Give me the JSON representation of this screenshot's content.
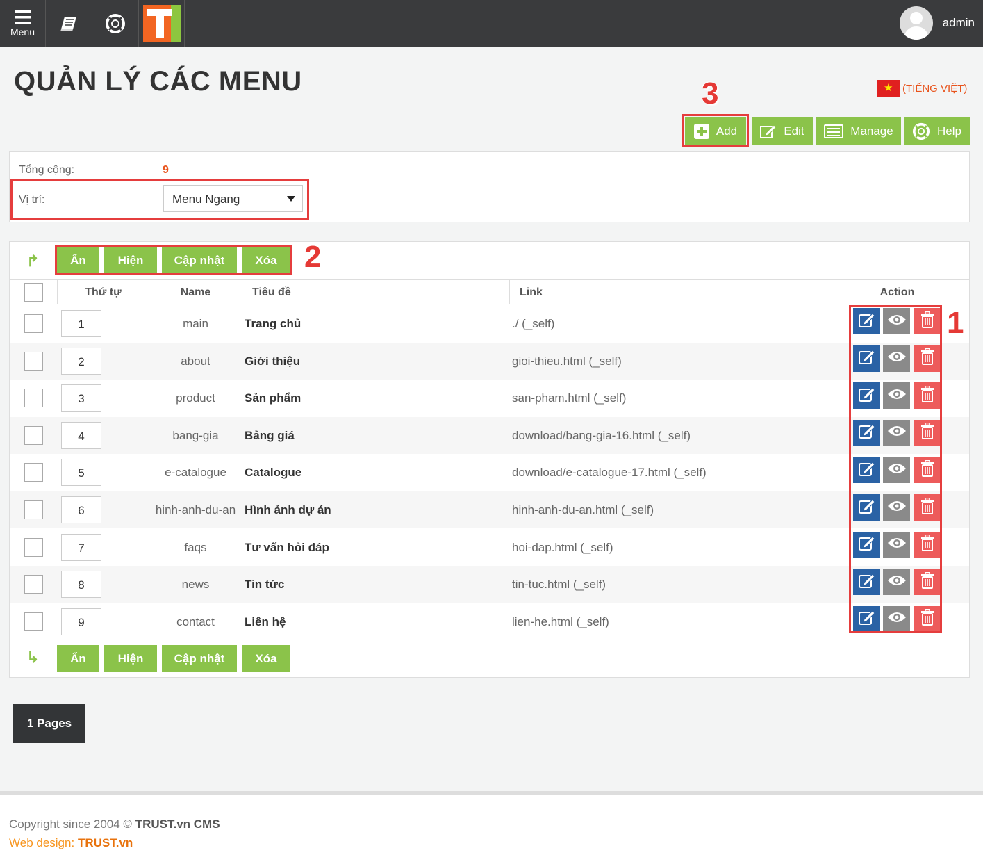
{
  "topbar": {
    "menu_label": "Menu",
    "user_name": "admin"
  },
  "page": {
    "title": "QUẢN LÝ CÁC MENU",
    "language": "(TIẾNG VIỆT)"
  },
  "toolbar": {
    "add": "Add",
    "edit": "Edit",
    "manage": "Manage",
    "help": "Help"
  },
  "annotations": {
    "a1": "1",
    "a2": "2",
    "a3": "3"
  },
  "summary": {
    "total_label": "Tổng cộng:",
    "total_value": "9",
    "position_label": "Vị trí:",
    "position_value": "Menu Ngang"
  },
  "actions": {
    "hide": "Ẩn",
    "show": "Hiện",
    "update": "Cập nhật",
    "delete": "Xóa"
  },
  "table": {
    "headers": {
      "order": "Thứ tự",
      "name": "Name",
      "title": "Tiêu đề",
      "link": "Link",
      "action": "Action"
    },
    "rows": [
      {
        "order": "1",
        "name": "main",
        "title": "Trang chủ",
        "link": "./ (_self)"
      },
      {
        "order": "2",
        "name": "about",
        "title": "Giới thiệu",
        "link": "gioi-thieu.html (_self)"
      },
      {
        "order": "3",
        "name": "product",
        "title": "Sản phẩm",
        "link": "san-pham.html (_self)"
      },
      {
        "order": "4",
        "name": "bang-gia",
        "title": "Bảng giá",
        "link": "download/bang-gia-16.html (_self)"
      },
      {
        "order": "5",
        "name": "e-catalogue",
        "title": "Catalogue",
        "link": "download/e-catalogue-17.html (_self)"
      },
      {
        "order": "6",
        "name": "hinh-anh-du-an",
        "title": "Hình ảnh dự án",
        "link": "hinh-anh-du-an.html (_self)"
      },
      {
        "order": "7",
        "name": "faqs",
        "title": "Tư vấn hỏi đáp",
        "link": "hoi-dap.html (_self)"
      },
      {
        "order": "8",
        "name": "news",
        "title": "Tin tức",
        "link": "tin-tuc.html (_self)"
      },
      {
        "order": "9",
        "name": "contact",
        "title": "Liên hệ",
        "link": "lien-he.html (_self)"
      }
    ]
  },
  "pagination": {
    "label": "1 Pages"
  },
  "footer": {
    "copyright_prefix": "Copyright since 2004 ©",
    "copyright_brand": "TRUST.vn CMS",
    "webdesign_prefix": "Web design:",
    "webdesign_brand": "TRUST.vn"
  },
  "colors": {
    "green": "#8bc34a",
    "blue": "#2a62a5",
    "gray": "#8a8a8a",
    "red": "#ed5b5b",
    "orange": "#e8531c",
    "annotation": "#e53935"
  },
  "icons": {
    "menu": "hamburger-icon",
    "book": "book-icon",
    "help": "lifebuoy-icon",
    "user": "user-avatar-icon",
    "add": "plus-icon",
    "edit": "pencil-icon",
    "manage": "list-icon",
    "view": "eye-icon",
    "delete": "trash-icon"
  }
}
